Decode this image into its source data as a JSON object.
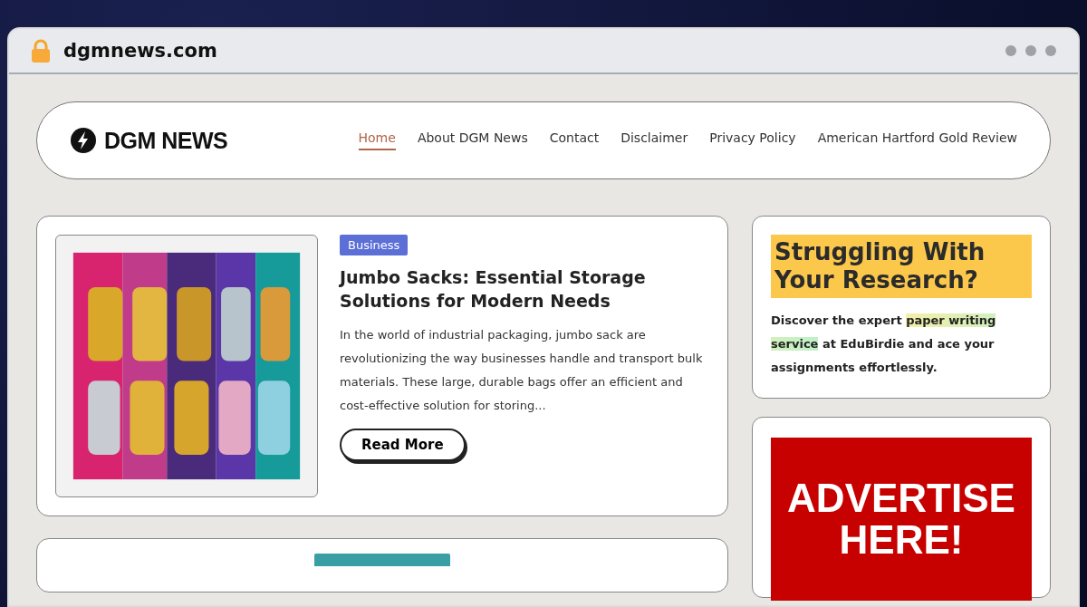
{
  "browser": {
    "url": "dgmnews.com"
  },
  "header": {
    "logo": "DGM NEWS",
    "nav": [
      {
        "label": "Home",
        "selected": true
      },
      {
        "label": "About DGM News",
        "selected": false
      },
      {
        "label": "Contact",
        "selected": false
      },
      {
        "label": "Disclaimer",
        "selected": false
      },
      {
        "label": "Privacy Policy",
        "selected": false
      },
      {
        "label": "American Hartford Gold Review",
        "selected": false
      }
    ]
  },
  "posts": [
    {
      "category": "Business",
      "color": "#5b6fd6",
      "title": "Jumbo Sacks: Essential Storage Solutions for Modern Needs",
      "excerpt": "In the world of industrial packaging, jumbo sack are revolutionizing the way businesses handle and transport bulk materials. These large, durable bags offer an efficient and cost-effective solution for storing...",
      "button": "Read More"
    },
    {
      "color": "#3a9ea5"
    }
  ],
  "sidebar": {
    "promo": {
      "heading": "Struggling With Your Research?",
      "text": [
        {
          "t": "Discover the expert ",
          "highlight": false
        },
        {
          "t": "paper writing service",
          "highlight": true
        },
        {
          "t": " at EduBirdie and ace your assignments effortlessly.",
          "highlight": false
        }
      ]
    },
    "ad": {
      "lines": [
        "ADVERTISE",
        "HERE!"
      ]
    }
  }
}
